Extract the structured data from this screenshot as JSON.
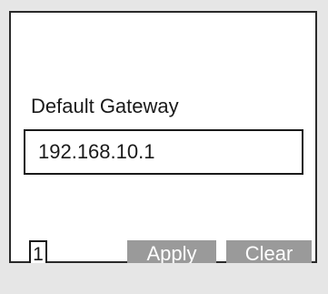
{
  "field": {
    "label": "Default Gateway",
    "value": "192.168.10.1"
  },
  "page_indicator": "1",
  "softkeys": {
    "apply_label": "Apply",
    "clear_label": "Clear"
  },
  "colors": {
    "softkey_bg": "#9a9a9a",
    "softkey_text": "#ffffff",
    "border": "#1a1a1a",
    "screen_bg": "#ffffff",
    "frame_bg": "#e6e6e6"
  }
}
